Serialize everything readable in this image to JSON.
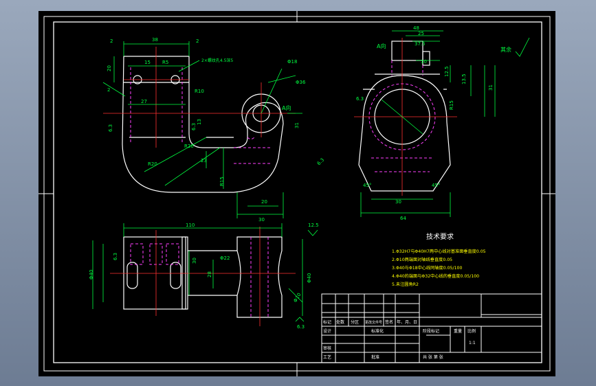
{
  "colors": {
    "background": "#000000",
    "outline": "#ffffff",
    "center_line": "#ff3030",
    "hidden_line": "#ff40ff",
    "dimension": "#00ff40",
    "cyan": "#00e0ff",
    "text": "#ffffff",
    "tech_text": "#ffff00",
    "viewport_bg_top": "#9aa8bc",
    "viewport_bg_bottom": "#6d7c93"
  },
  "view_labels": {
    "a_direction_top": "A向",
    "a_direction_side": "A向",
    "rest_surface": "其余"
  },
  "dimensions": {
    "front": {
      "d_top_width": "38",
      "d_gap_left": "2",
      "d_gap_right": "2",
      "d_left_20": "20",
      "d_15": "15",
      "d_r5": "R5",
      "d_27": "27",
      "d_chamfer": "2",
      "d_hole_note": "2×螺纹孔4.5深5",
      "d_r10": "R10",
      "d_13": "13",
      "d_phi18": "Φ18",
      "d_phi36": "Φ36",
      "d_31": "31",
      "d_r20_1": "R20",
      "d_r20_2": "R20",
      "d_23": "23",
      "d_r15": "R15",
      "d_20_bottom": "20",
      "d_30_bottom": "30",
      "rough_left": "6.3",
      "rough_mid": "6.3",
      "rough_lower": "6.3"
    },
    "side": {
      "d_48": "48",
      "d_25": "25",
      "d_37": "37.5",
      "d_10": "10",
      "d_12": "12.5",
      "d_13": "13.5",
      "d_31": "31",
      "d_r15": "R15",
      "d_30": "30",
      "d_45_left": "45°",
      "d_45_right": "45°",
      "d_64": "64",
      "rough_right": "6.3"
    },
    "bottom": {
      "d_total": "110",
      "d_phi40": "Φ40",
      "d_30": "30",
      "d_28": "28",
      "d_phi22": "Φ22",
      "d_phi10": "Φ10",
      "d_phi40_r": "Φ40",
      "d_12": "12.5",
      "rough_left": "6.3",
      "rough_bottom": "6.3"
    }
  },
  "tech": {
    "title": "技术要求",
    "items": [
      "1.Φ32H7与Φ40H7两中心线对基准面垂直度0.05",
      "2.Φ10两端面对轴线垂直度0.05",
      "3.Φ40与Φ18中心线同轴度0.05/100",
      "4.Φ40的端面与Φ32中心线的垂直度0.05/100",
      "5.未注圆角R2"
    ]
  },
  "title_block": {
    "row1": [
      "标记",
      "处数",
      "分区",
      "更改文件号",
      "签名",
      "年、月、日"
    ],
    "design": "设计",
    "standardize": "标准化",
    "review": "审核",
    "process": "工艺",
    "approve": "批准",
    "stage_mark": "阶段标记",
    "weight": "重量",
    "scale_label": "比例",
    "scale": "1:1",
    "sheets": "共 张 第 张"
  }
}
